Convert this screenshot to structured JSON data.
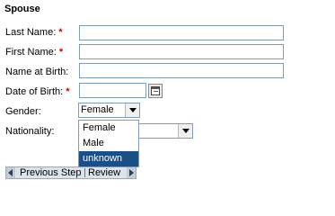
{
  "section": {
    "title": "Spouse"
  },
  "fields": {
    "last_name": {
      "label": "Last Name:",
      "required_mark": "*",
      "value": ""
    },
    "first_name": {
      "label": "First Name:",
      "required_mark": "*",
      "value": ""
    },
    "name_at_birth": {
      "label": "Name at Birth:",
      "value": ""
    },
    "date_of_birth": {
      "label": "Date of Birth:",
      "required_mark": "*",
      "value": ""
    },
    "gender": {
      "label": "Gender:",
      "selected": "Female"
    },
    "nationality": {
      "label": "Nationality:",
      "selected": ""
    }
  },
  "gender_dropdown": {
    "options": [
      "Female",
      "Male",
      "unknown"
    ],
    "highlighted": "unknown"
  },
  "wizard": {
    "previous_label": "Previous Step",
    "current_label": "Review"
  },
  "icons": {
    "date_picker": "calendar-icon",
    "dropdown": "chevron-down-icon",
    "prev": "triangle-left-icon",
    "next": "triangle-right-icon"
  },
  "colors": {
    "required": "#d40000",
    "input_border": "#7f9db9",
    "selected_option": "#1c4f86"
  }
}
